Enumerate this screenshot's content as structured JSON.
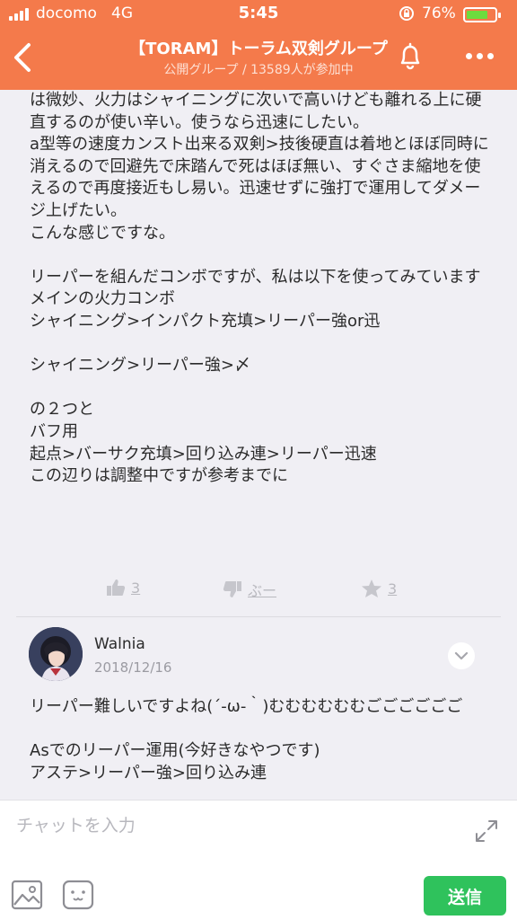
{
  "status_bar": {
    "carrier": "docomo",
    "network": "4G",
    "time": "5:45",
    "battery_percent": "76%",
    "battery_level": 0.76
  },
  "header": {
    "title": "【TORAM】トーラム双剣グループ",
    "subtitle": "公開グループ / 13589人が参加中",
    "icons": [
      "back-icon",
      "bell-icon",
      "more-icon"
    ],
    "background_color": "#f47a4b"
  },
  "post": {
    "body": "は微妙、火力はシャイニングに次いで高いけども離れる上に硬直するのが使い辛い。使うなら迅速にしたい。\na型等の速度カンスト出来る双剣>技後硬直は着地とほぼ同時に消えるので回避先で床踏んで死はほぼ無い、すぐさま縮地を使えるので再度接近もし易い。迅速せずに強打で運用してダメージ上げたい。\nこんな感じですな。\n\nリーパーを組んだコンボですが、私は以下を使ってみています\nメインの火力コンボ\nシャイニング>インパクト充填>リーパー強or迅\n\nシャイニング>リーパー強>〆\n\nの２つと\nバフ用\n起点>バーサク充填>回り込み連>リーパー迅速\nこの辺りは調整中ですが参考までに",
    "reactions": {
      "like_count": "3",
      "boo_label": "ぶー",
      "star_count": "3"
    }
  },
  "comment": {
    "author": "Walnia",
    "date": "2018/12/16",
    "body": "リーパー難しいですよね(´-ω-｀)むむむむむむごごごごごご\n\nAsでのリーパー運用(今好きなやつです)\nアステ>リーパー強>回り込み連"
  },
  "input_bar": {
    "placeholder": "チャットを入力",
    "send_label": "送信",
    "send_color": "#2fc25c"
  }
}
